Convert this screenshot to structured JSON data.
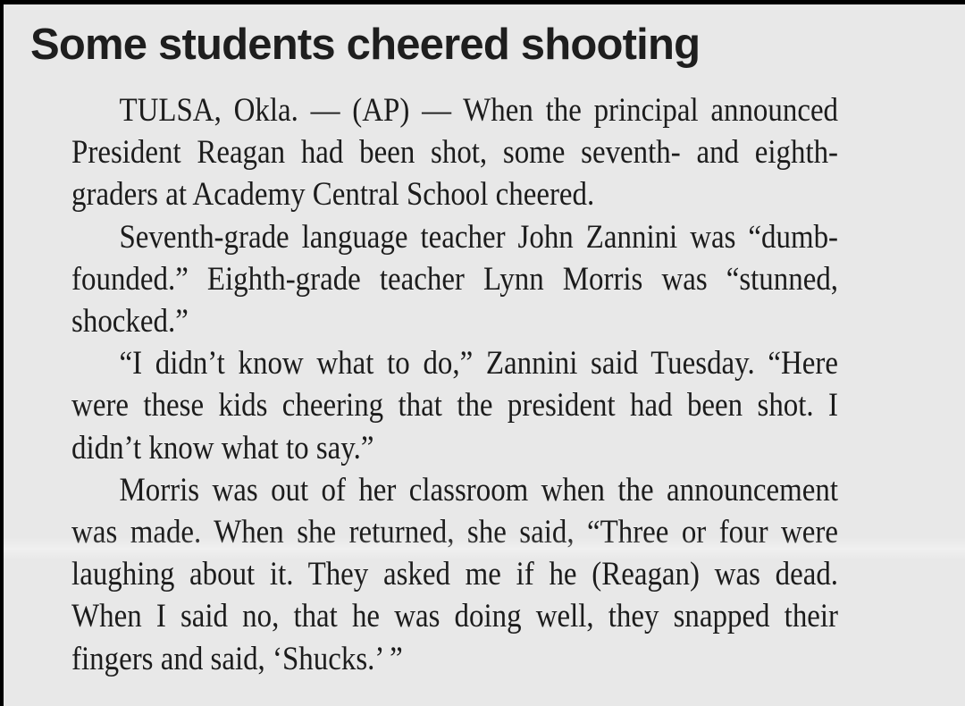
{
  "headline": "Some students cheered shooting",
  "paragraphs": [
    {
      "lines": [
        "TULSA, Okla. — (AP) — When the principal announced",
        "President Reagan had been shot, some seventh- and eighth-",
        "graders at Academy Central School cheered."
      ]
    },
    {
      "lines": [
        "Seventh-grade language teacher John Zannini was “dumb-",
        "founded.” Eighth-grade teacher Lynn Morris was “stunned,",
        "shocked.”"
      ]
    },
    {
      "lines": [
        "“I didn’t know what to do,” Zannini said Tuesday. “Here",
        "were these kids cheering that the president had been shot. I",
        "didn’t know what to say.”"
      ]
    },
    {
      "lines": [
        "Morris was out of her classroom when the announcement",
        "was made. When she returned, she said, “Three or four were",
        "laughing about it. They asked me if he (Reagan) was dead.",
        "When I said no, that he was doing well, they snapped their",
        "fingers and said, ‘Shucks.’ ”"
      ]
    }
  ]
}
